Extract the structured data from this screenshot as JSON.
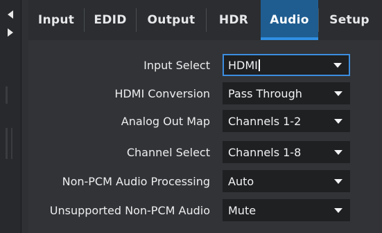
{
  "tabs": [
    {
      "label": "Input"
    },
    {
      "label": "EDID"
    },
    {
      "label": "Output"
    },
    {
      "label": "HDR"
    },
    {
      "label": "Audio"
    },
    {
      "label": "Setup"
    }
  ],
  "active_tab": "Audio",
  "settings": [
    {
      "label": "Input Select",
      "value": "HDMI"
    },
    {
      "label": "HDMI Conversion",
      "value": "Pass Through"
    },
    {
      "label": "Analog Out Map",
      "value": "Channels 1-2"
    },
    {
      "label": "Channel Select",
      "value": "Channels 1-8"
    },
    {
      "label": "Non-PCM Audio Processing",
      "value": "Auto"
    },
    {
      "label": "Unsupported Non-PCM Audio",
      "value": "Mute"
    }
  ],
  "colors": {
    "accent": "#2f8fe2",
    "active_tab_bg": "#1f5d91",
    "panel_bg": "#313336"
  },
  "icons": {
    "scroll_left": "left-triangle-icon",
    "scroll_right": "right-triangle-icon",
    "dropdown": "caret-down-icon"
  }
}
